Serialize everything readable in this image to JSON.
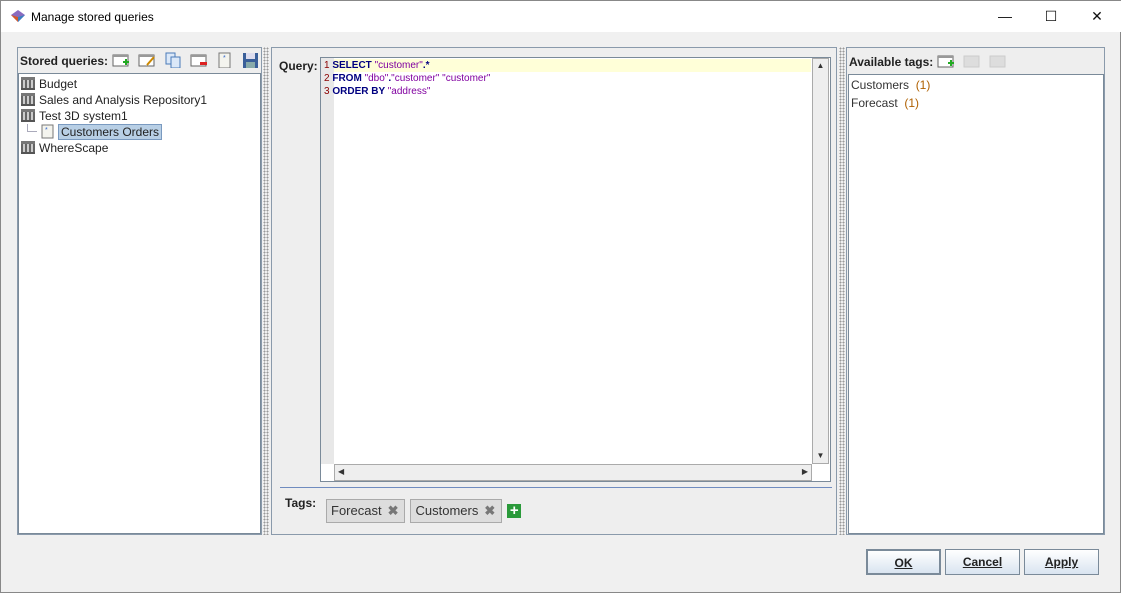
{
  "window": {
    "title": "Manage stored queries",
    "minimize": "—",
    "maximize": "☐",
    "close": "✕"
  },
  "left": {
    "header": "Stored queries:",
    "toolbar": [
      "new-query",
      "edit-query",
      "copy-query",
      "delete-query",
      "query-properties",
      "save-query"
    ],
    "tree": [
      {
        "label": "Budget",
        "type": "repository"
      },
      {
        "label": "Sales and Analysis Repository1",
        "type": "repository"
      },
      {
        "label": "Test 3D system1",
        "type": "repository"
      },
      {
        "label": "Customers Orders",
        "type": "query",
        "selected": true
      },
      {
        "label": "WhereScape",
        "type": "repository"
      }
    ]
  },
  "query": {
    "label": "Query:",
    "lines": [
      {
        "n": "1",
        "parts": [
          {
            "t": "SELECT ",
            "k": "kw"
          },
          {
            "t": "\"customer\"",
            "k": "str"
          },
          {
            "t": ".*",
            "k": "kw"
          }
        ]
      },
      {
        "n": "2",
        "parts": [
          {
            "t": "FROM ",
            "k": "kw"
          },
          {
            "t": "\"dbo\"",
            "k": "str"
          },
          {
            "t": ".",
            "k": "kw"
          },
          {
            "t": "\"customer\" \"customer\"",
            "k": "str"
          }
        ]
      },
      {
        "n": "3",
        "parts": [
          {
            "t": "ORDER BY ",
            "k": "kw"
          },
          {
            "t": "\"address\"",
            "k": "str"
          }
        ]
      }
    ]
  },
  "tags": {
    "label": "Tags:",
    "items": [
      "Forecast",
      "Customers"
    ],
    "remove": "✖",
    "add": "+"
  },
  "available": {
    "header": "Available tags:",
    "items": [
      {
        "name": "Customers",
        "count": "(1)"
      },
      {
        "name": "Forecast",
        "count": "(1)"
      }
    ]
  },
  "buttons": {
    "ok": "OK",
    "cancel": "Cancel",
    "apply": "Apply"
  }
}
